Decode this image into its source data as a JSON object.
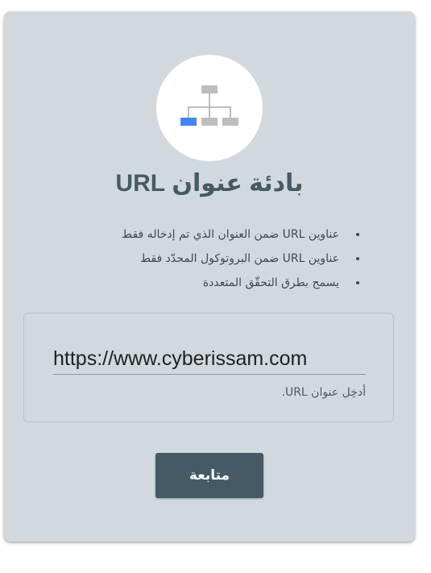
{
  "card": {
    "title": "بادئة عنوان URL",
    "icon": "sitemap-icon",
    "bullets": [
      "عناوين URL ضمن العنوان الذي تم إدخاله فقط",
      "عناوين URL ضمن البروتوكول المحدّد فقط",
      "يسمح بطرق التحقّق المتعددة"
    ],
    "url_input": {
      "value": "https://www.cyberissam.com",
      "helper": "أدخِل عنوان URL."
    },
    "continue_label": "متابعة"
  },
  "colors": {
    "card_background": "#d2d9de",
    "title": "#455a64",
    "button": "#455a64",
    "icon_accent": "#4285f4",
    "icon_gray": "#bdbdbd"
  }
}
